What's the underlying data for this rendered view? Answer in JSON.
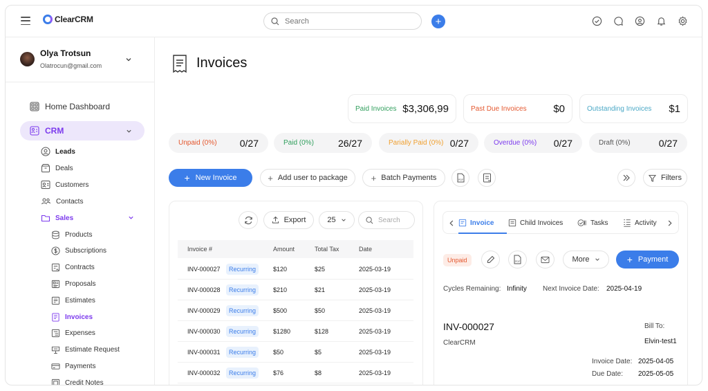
{
  "app": {
    "logo_text": "ClearCRM"
  },
  "topbar": {
    "search_placeholder": "Search",
    "add_label": "+"
  },
  "user": {
    "name": "Olya Trotsun",
    "email": "Olatrocun@gmail.com"
  },
  "sidebar": {
    "home": "Home Dashboard",
    "crm": "CRM",
    "crm_items": [
      "Leads",
      "Deals",
      "Customers",
      "Contacts"
    ],
    "sales": "Sales",
    "sales_items": [
      "Products",
      "Subscriptions",
      "Contracts",
      "Proposals",
      "Estimates",
      "Invoices",
      "Expenses",
      "Estimate Request",
      "Payments",
      "Credit Notes"
    ]
  },
  "page": {
    "title": "Invoices"
  },
  "stats": [
    {
      "label": "Paid Invoices",
      "value": "$3,306,99",
      "color": "#2f9e5c"
    },
    {
      "label": "Past Due Invoices",
      "value": "$0",
      "color": "#e4572e"
    },
    {
      "label": "Outstanding Invoices",
      "value": "$1",
      "color": "#4aa8c6"
    }
  ],
  "pills": [
    {
      "label": "Unpaid (0%)",
      "value": "0/27",
      "color": "#e4572e"
    },
    {
      "label": "Paid (0%)",
      "value": "26/27",
      "color": "#2f9e5c"
    },
    {
      "label": "Parially Paid (0%)",
      "value": "0/27",
      "color": "#f0a030"
    },
    {
      "label": "Overdue (0%)",
      "value": "0/27",
      "color": "#7c3aed"
    },
    {
      "label": "Draft (0%)",
      "value": "0/27",
      "color": "#555555"
    }
  ],
  "actions": {
    "new_invoice": "New Invoice",
    "add_user": "Add user to package",
    "batch_payments": "Batch Payments",
    "filters": "Filters"
  },
  "list": {
    "export": "Export",
    "page_size": "25",
    "search_placeholder": "Search",
    "columns": [
      "Invoice #",
      "Amount",
      "Total Tax",
      "Date"
    ],
    "rows": [
      {
        "id": "INV-000027",
        "status": "Recurring",
        "amount": "$120",
        "tax": "$25",
        "date": "2025-03-19"
      },
      {
        "id": "INV-000028",
        "status": "Recurring",
        "amount": "$210",
        "tax": "$21",
        "date": "2025-03-19"
      },
      {
        "id": "INV-000029",
        "status": "Recurring",
        "amount": "$500",
        "tax": "$50",
        "date": "2025-03-19"
      },
      {
        "id": "INV-000030",
        "status": "Recurring",
        "amount": "$1280",
        "tax": "$128",
        "date": "2025-03-19"
      },
      {
        "id": "INV-000031",
        "status": "Recurring",
        "amount": "$50",
        "tax": "$5",
        "date": "2025-03-19"
      },
      {
        "id": "INV-000032",
        "status": "Recurring",
        "amount": "$76",
        "tax": "$8",
        "date": "2025-03-19"
      }
    ]
  },
  "detail": {
    "tabs": [
      "Invoice",
      "Child Invoices",
      "Tasks",
      "Activity"
    ],
    "status": "Unpaid",
    "more": "More",
    "payment": "Payment",
    "cycles_label": "Cycles Remaining:",
    "cycles_value": "Infinity",
    "next_label": "Next Invoice Date:",
    "next_value": "2025-04-19",
    "invoice_no": "INV-000027",
    "company": "ClearCRM",
    "bill_to_label": "Bill To:",
    "bill_to_value": "Elvin-test1",
    "invoice_date_label": "Invoice Date:",
    "invoice_date_value": "2025-04-05",
    "due_date_label": "Due Date:",
    "due_date_value": "2025-05-05"
  }
}
